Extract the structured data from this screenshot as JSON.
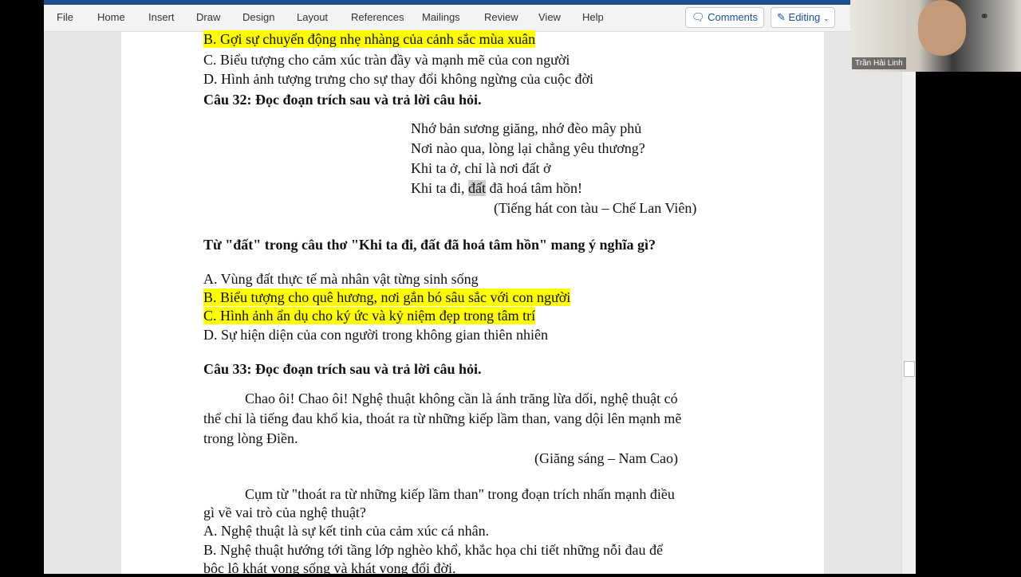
{
  "ribbon": {
    "tabs": [
      "File",
      "Home",
      "Insert",
      "Draw",
      "Design",
      "Layout",
      "References",
      "Mailings",
      "Review",
      "View",
      "Help"
    ],
    "comments": "Comments",
    "editing": "Editing"
  },
  "webcam": {
    "name": "Trần Hải Linh"
  },
  "doc": {
    "q31_b": "B. Gợi sự chuyển động nhẹ nhàng của cảnh sắc mùa xuân",
    "q31_c": "C. Biểu tượng cho cảm xúc tràn đầy và mạnh mẽ của con người",
    "q31_d": "D. Hình ảnh tượng trưng cho sự thay đổi không ngừng của cuộc đời",
    "q32_title": "Câu 32: Đọc đoạn trích sau và trả lời câu hỏi.",
    "poem": [
      "Nhớ bản sương giăng, nhớ đèo mây phủ",
      "Nơi nào qua, lòng lại chẳng yêu thương?",
      "Khi ta ở, chỉ là nơi đất ở",
      "Khi ta đi, ",
      "đất",
      " đã hoá tâm hồn!"
    ],
    "poem_source": "(Tiếng hát con tàu – Chế Lan Viên)",
    "q32_question": "Từ \"đất\" trong câu thơ \"Khi ta đi, đất đã hoá tâm hồn\" mang ý nghĩa gì?",
    "q32_a": "A. Vùng đất thực tế mà nhân vật từng sinh sống",
    "q32_b": "B. Biểu tượng cho quê hương, nơi gắn bó sâu sắc với con người",
    "q32_c": "C. Hình ảnh ẩn dụ cho ký ức và kỷ niệm đẹp trong tâm trí",
    "q32_d": "D. Sự hiện diện của con người trong không gian thiên nhiên",
    "q33_title": "Câu 33: Đọc đoạn trích sau và trả lời câu hỏi.",
    "q33_passage": [
      "Chao ôi! Chao ôi! Nghệ thuật không cần là ánh trăng lừa dối, nghệ thuật có",
      "thể chỉ là tiếng đau khổ kia, thoát ra từ những kiếp lầm than, vang dội lên mạnh mẽ",
      "trong lòng Điền."
    ],
    "q33_source": "(Giăng sáng – Nam Cao)",
    "q33_question": [
      "Cụm từ \"thoát ra từ những kiếp lầm than\" trong đoạn trích nhấn mạnh điều",
      "gì về vai trò của nghệ thuật?"
    ],
    "q33_a": "A. Nghệ thuật là sự kết tinh của cảm xúc cá nhân.",
    "q33_b": [
      "B. Nghệ thuật hướng tới tầng lớp nghèo khổ, khắc họa chi tiết những nỗi đau để",
      "bộc lộ khát vọng sống và khát vọng đổi đời."
    ]
  }
}
